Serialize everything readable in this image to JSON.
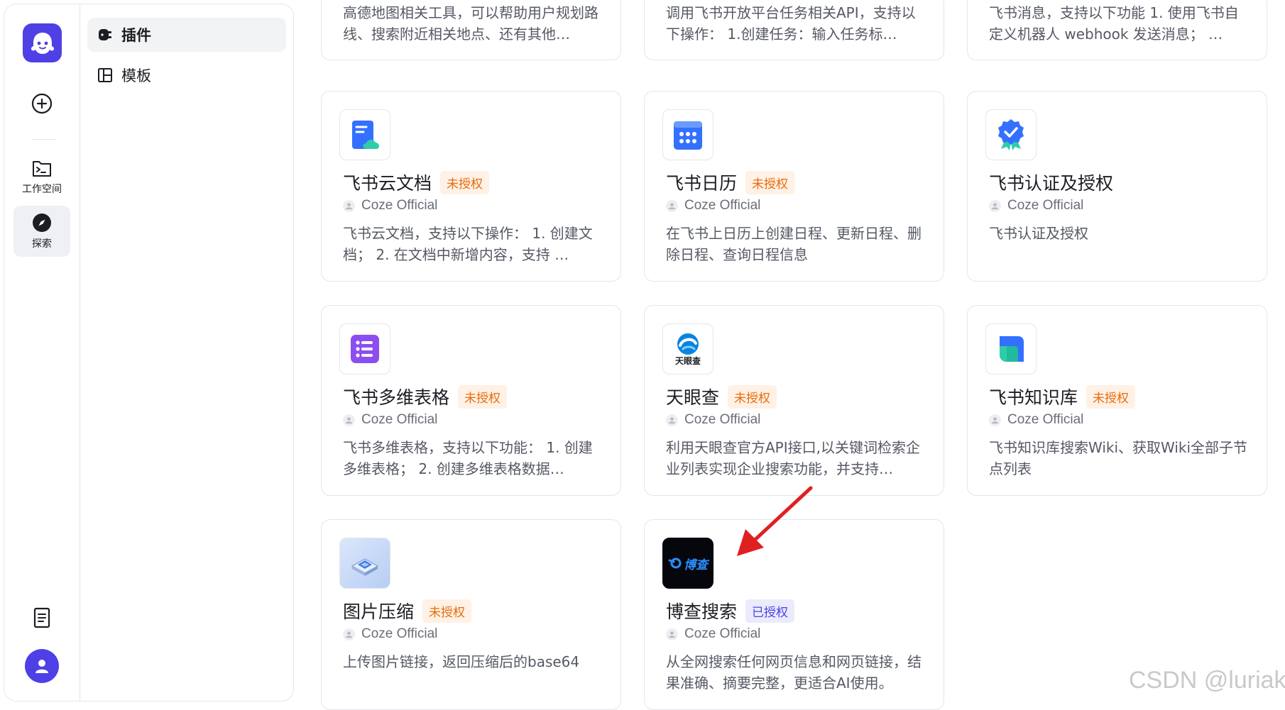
{
  "rail": {
    "workspace_label": "工作空间",
    "explore_label": "探索"
  },
  "subnav": {
    "items": [
      {
        "label": "插件",
        "active": true
      },
      {
        "label": "模板",
        "active": false
      }
    ]
  },
  "top_cards": [
    {
      "desc": "高德地图相关工具，可以帮助用户规划路线、搜索附近相关地点、还有其他…"
    },
    {
      "desc": "调用飞书开放平台任务相关API，支持以下操作： 1.创建任务：输入任务标…"
    },
    {
      "desc": "飞书消息，支持以下功能 1. 使用飞书自定义机器人 webhook 发送消息； …"
    }
  ],
  "cards": [
    {
      "title": "飞书云文档",
      "badge": "未授权",
      "author": "Coze Official",
      "desc": "飞书云文档，支持以下操作： 1. 创建文档； 2. 在文档中新增内容，支持 …",
      "icon": "feishu-doc-icon"
    },
    {
      "title": "飞书日历",
      "badge": "未授权",
      "author": "Coze Official",
      "desc": "在飞书上日历上创建日程、更新日程、删除日程、查询日程信息",
      "icon": "feishu-calendar-icon"
    },
    {
      "title": "飞书认证及授权",
      "badge": "",
      "author": "Coze Official",
      "desc": "飞书认证及授权",
      "icon": "feishu-auth-icon"
    },
    {
      "title": "飞书多维表格",
      "badge": "未授权",
      "author": "Coze Official",
      "desc": "飞书多维表格，支持以下功能： 1. 创建多维表格； 2. 创建多维表格数据…",
      "icon": "feishu-bitable-icon"
    },
    {
      "title": "天眼查",
      "badge": "未授权",
      "author": "Coze Official",
      "desc": "利用天眼查官方API接口,以关键词检索企业列表实现企业搜索功能，并支持…",
      "icon": "tianyancha-icon",
      "icon_text": "天眼查"
    },
    {
      "title": "飞书知识库",
      "badge": "未授权",
      "author": "Coze Official",
      "desc": "飞书知识库搜索Wiki、获取Wiki全部子节点列表",
      "icon": "feishu-wiki-icon"
    },
    {
      "title": "图片压缩",
      "badge": "未授权",
      "author": "Coze Official",
      "desc": "上传图片链接，返回压缩后的base64",
      "icon": "image-compress-icon"
    },
    {
      "title": "博查搜索",
      "badge": "已授权",
      "author": "Coze Official",
      "desc": "从全网搜索任何网页信息和网页链接，结果准确、摘要完整，更适合AI使用。",
      "icon": "bocha-search-icon",
      "icon_text": "博查"
    }
  ],
  "colors": {
    "brand": "#4e40e5",
    "unauth_text": "#e86c0c",
    "auth_text": "#4d43e3",
    "annotation_arrow": "#e02020"
  },
  "watermark": "CSDN @luriak"
}
